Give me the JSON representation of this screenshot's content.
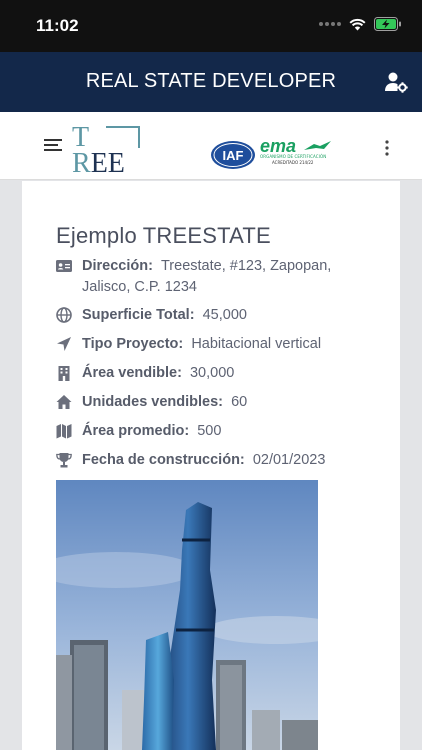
{
  "status_bar": {
    "time": "11:02"
  },
  "header": {
    "title": "REAL STATE DEVELOPER"
  },
  "toolbar": {
    "logo_line1_a": "T",
    "logo_line2_a": "R",
    "logo_line2_b": "EE",
    "iaf_text": "IAF",
    "ema_text": "ema",
    "ema_sub": "ORGANISMO DE CERTIFICACIÓN",
    "ema_sub2": "ACREDITADO 214/22"
  },
  "property": {
    "title": "Ejemplo TREESTATE",
    "fields": [
      {
        "label": "Dirección:",
        "value": "Treestate, #123, Zapopan, Jalisco, C.P. 1234",
        "icon": "id-card-icon"
      },
      {
        "label": "Superficie Total:",
        "value": "45,000",
        "icon": "globe-icon"
      },
      {
        "label": "Tipo Proyecto:",
        "value": "Habitacional vertical",
        "icon": "location-arrow-icon"
      },
      {
        "label": "Área vendible:",
        "value": "30,000",
        "icon": "building-icon"
      },
      {
        "label": "Unidades vendibles:",
        "value": "60",
        "icon": "home-icon"
      },
      {
        "label": "Área promedio:",
        "value": "500",
        "icon": "map-icon"
      },
      {
        "label": "Fecha de construcción:",
        "value": "02/01/2023",
        "icon": "trophy-icon"
      }
    ]
  },
  "colors": {
    "header_bg": "#13284a",
    "text": "#5e6373"
  }
}
